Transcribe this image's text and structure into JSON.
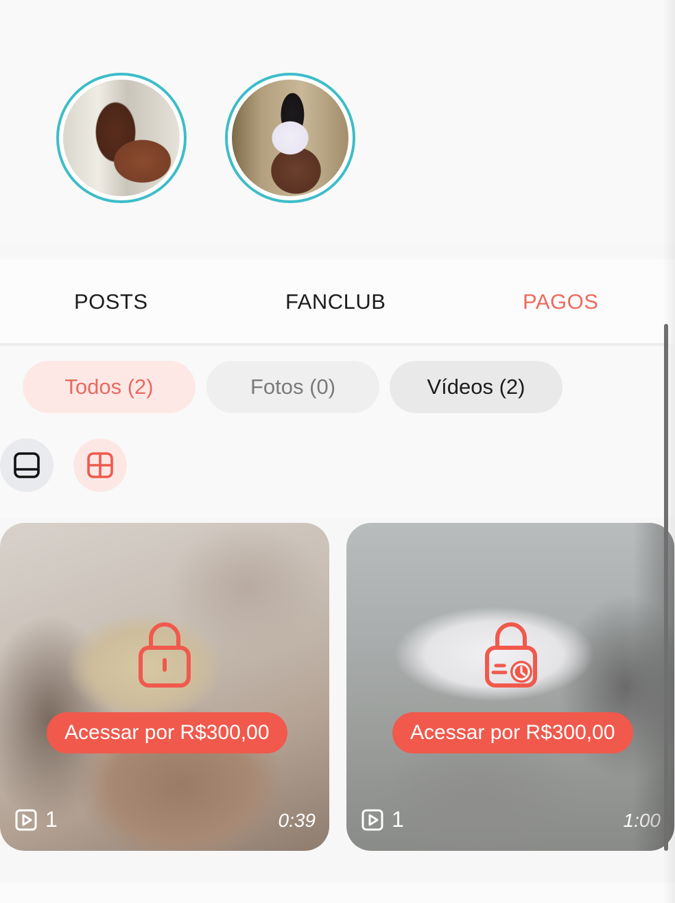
{
  "stories": [
    {
      "name": "story-1"
    },
    {
      "name": "story-2"
    }
  ],
  "tabs": {
    "posts": "POSTS",
    "fanclub": "FANCLUB",
    "pagos": "PAGOS",
    "active": "PAGOS"
  },
  "filters": {
    "todos": "Todos (2)",
    "fotos": "Fotos (0)",
    "videos": "Vídeos (2)",
    "active": "Todos (2)"
  },
  "view_toggle": {
    "list_icon": "single-column-icon",
    "grid_icon": "grid-icon",
    "active": "grid"
  },
  "cards": [
    {
      "lock_icon": "lock-icon",
      "price_label": "Acessar por R$300,00",
      "media_icon": "play-icon",
      "media_count": "1",
      "duration": "0:39"
    },
    {
      "lock_icon": "lock-clock-icon",
      "price_label": "Acessar por R$300,00",
      "media_icon": "play-icon",
      "media_count": "1",
      "duration": "1:00"
    }
  ],
  "colors": {
    "accent": "#f0594c",
    "active_tab": "#ee6a5b",
    "story_ring": "#3dbdc8"
  }
}
